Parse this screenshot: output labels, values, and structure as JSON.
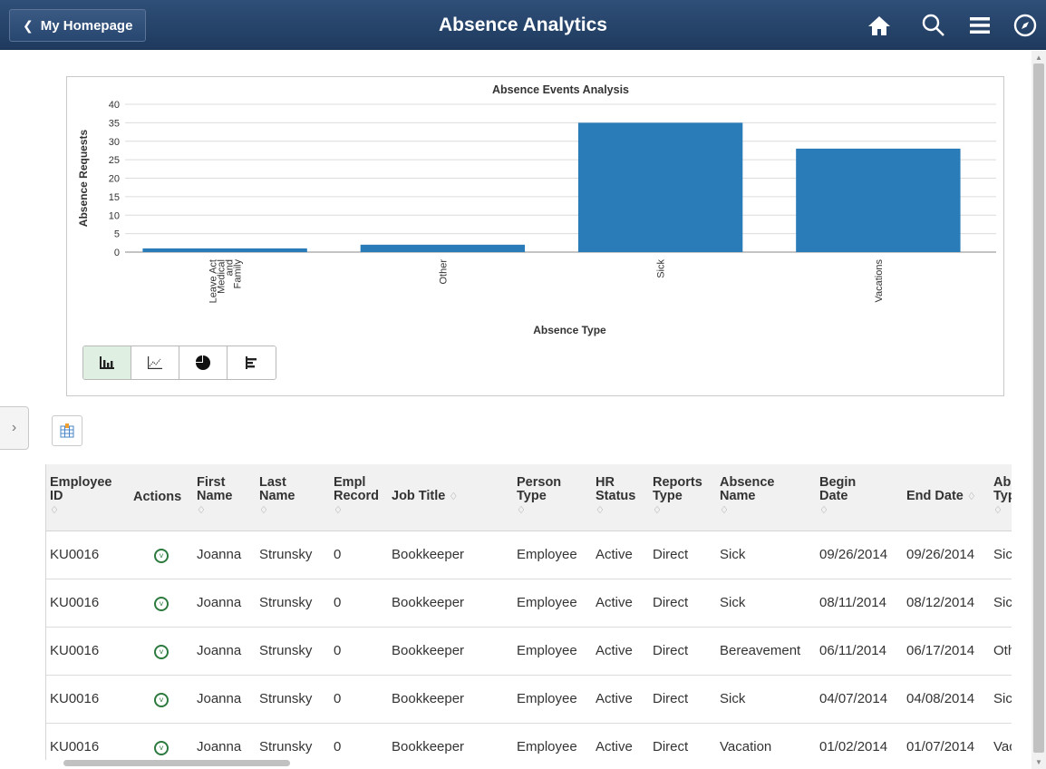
{
  "header": {
    "back_label": "My Homepage",
    "title": "Absence Analytics"
  },
  "chart_data": {
    "type": "bar",
    "title": "Absence Events Analysis",
    "xlabel": "Absence Type",
    "ylabel": "Absence Requests",
    "categories": [
      "Family and Medical Leave Act",
      "Other",
      "Sick",
      "Vacations"
    ],
    "category_lines": [
      [
        "Family",
        "and",
        "Medical",
        "Leave Act"
      ],
      [
        "Other"
      ],
      [
        "Sick"
      ],
      [
        "Vacations"
      ]
    ],
    "values": [
      1,
      2,
      35,
      28
    ],
    "ylim": [
      0,
      40
    ],
    "yticks": [
      0,
      5,
      10,
      15,
      20,
      25,
      30,
      35,
      40
    ],
    "grid": true,
    "bar_color": "#2a7cb8"
  },
  "chart_toolbar": [
    "bar-chart-icon",
    "line-chart-icon",
    "pie-chart-icon",
    "horizontal-bar-icon"
  ],
  "table": {
    "columns": [
      {
        "label": "Employee ID",
        "lines": [
          "Employee",
          "ID"
        ],
        "sortable": true
      },
      {
        "label": "Actions",
        "lines": [
          "Actions"
        ],
        "sortable": false
      },
      {
        "label": "First Name",
        "lines": [
          "First",
          "Name"
        ],
        "sortable": true
      },
      {
        "label": "Last Name",
        "lines": [
          "Last",
          "Name"
        ],
        "sortable": true
      },
      {
        "label": "Empl Record",
        "lines": [
          "Empl",
          "Record"
        ],
        "sortable": true
      },
      {
        "label": "Job Title",
        "lines": [
          "Job Title"
        ],
        "sortable": true
      },
      {
        "label": "Person Type",
        "lines": [
          "Person",
          "Type"
        ],
        "sortable": true
      },
      {
        "label": "HR Status",
        "lines": [
          "HR",
          "Status"
        ],
        "sortable": true
      },
      {
        "label": "Reports Type",
        "lines": [
          "Reports",
          "Type"
        ],
        "sortable": true
      },
      {
        "label": "Absence Name",
        "lines": [
          "Absence",
          "Name"
        ],
        "sortable": true
      },
      {
        "label": "Begin Date",
        "lines": [
          "Begin",
          "Date"
        ],
        "sortable": true
      },
      {
        "label": "End Date",
        "lines": [
          "End Date"
        ],
        "sortable": true
      },
      {
        "label": "Absence Type",
        "lines": [
          "Absence",
          "Type"
        ],
        "sortable": true
      }
    ],
    "rows": [
      [
        "KU0016",
        "",
        "Joanna",
        "Strunsky",
        "0",
        "Bookkeeper",
        "Employee",
        "Active",
        "Direct",
        "Sick",
        "09/26/2014",
        "09/26/2014",
        "Sick"
      ],
      [
        "KU0016",
        "",
        "Joanna",
        "Strunsky",
        "0",
        "Bookkeeper",
        "Employee",
        "Active",
        "Direct",
        "Sick",
        "08/11/2014",
        "08/12/2014",
        "Sick"
      ],
      [
        "KU0016",
        "",
        "Joanna",
        "Strunsky",
        "0",
        "Bookkeeper",
        "Employee",
        "Active",
        "Direct",
        "Bereavement",
        "06/11/2014",
        "06/17/2014",
        "Other"
      ],
      [
        "KU0016",
        "",
        "Joanna",
        "Strunsky",
        "0",
        "Bookkeeper",
        "Employee",
        "Active",
        "Direct",
        "Sick",
        "04/07/2014",
        "04/08/2014",
        "Sick"
      ],
      [
        "KU0016",
        "",
        "Joanna",
        "Strunsky",
        "0",
        "Bookkeeper",
        "Employee",
        "Active",
        "Direct",
        "Vacation",
        "01/02/2014",
        "01/07/2014",
        "Vacations"
      ]
    ]
  }
}
